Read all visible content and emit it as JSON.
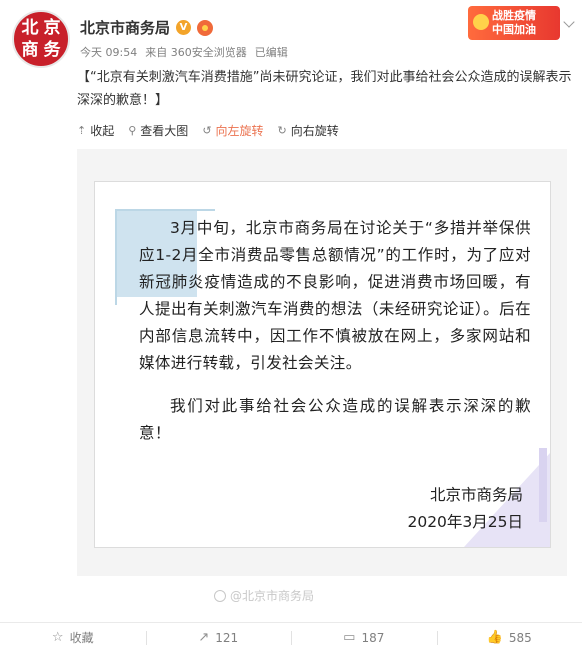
{
  "account": {
    "avatar_glyphs": [
      "北",
      "京",
      "商",
      "务"
    ],
    "name": "北京市商务局",
    "verified_badge": "V",
    "timestamp": "今天 09:54",
    "source": "来自 360安全浏览器",
    "edited": "已编辑"
  },
  "promo": {
    "line1": "战胜疫情",
    "line2": "中国加油"
  },
  "post": {
    "text": "【“北京有关刺激汽车消费措施”尚未研究论证，我们对此事给社会公众造成的误解表示深深的歉意！】"
  },
  "toolbar": {
    "collapse": "收起",
    "view_large": "查看大图",
    "rotate_left": "向左旋转",
    "rotate_right": "向右旋转"
  },
  "notice": {
    "paragraph1": "3月中旬，北京市商务局在讨论关于“多措并举保供应1-2月全市消费品零售总额情况”的工作时，为了应对新冠肺炎疫情造成的不良影响，促进消费市场回暖，有人提出有关刺激汽车消费的想法（未经研究论证）。后在内部信息流转中，因工作不慎被放在网上，多家网站和媒体进行转载，引发社会关注。",
    "paragraph2": "我们对此事给社会公众造成的误解表示深深的歉意！",
    "signature": "北京市商务局",
    "date": "2020年3月25日",
    "watermark": "@北京市商务局"
  },
  "actions": {
    "favorite": "收藏",
    "repost_count": "121",
    "comment_count": "187",
    "like_count": "585"
  },
  "colors": {
    "accent": "#eb7350",
    "avatar_red": "#c8202a"
  }
}
